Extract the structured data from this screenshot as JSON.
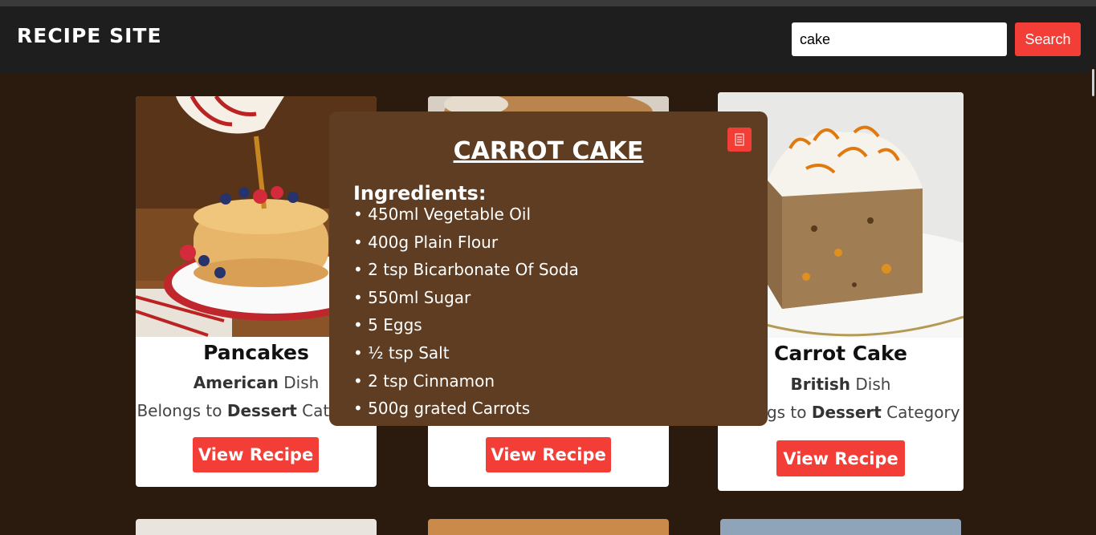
{
  "header": {
    "site_title": "RECIPE SITE",
    "search_value": "cake",
    "search_button": "Search"
  },
  "cards": [
    {
      "title": "Pancakes",
      "area": "American",
      "area_suffix": " Dish",
      "cat_prefix": "Belongs to ",
      "category": "Dessert",
      "cat_suffix": " Category",
      "button": "View Recipe"
    },
    {
      "title": "",
      "area": "",
      "area_suffix": "",
      "cat_prefix": "",
      "category": "",
      "cat_suffix": "",
      "button": "View Recipe"
    },
    {
      "title": "Carrot Cake",
      "area": "British",
      "area_suffix": " Dish",
      "cat_prefix": "Belongs to ",
      "category": "Dessert",
      "cat_suffix": " Category",
      "button": "View Recipe"
    }
  ],
  "modal": {
    "title": "CARROT CAKE",
    "ingredients_heading": "Ingredients:",
    "ingredients": [
      "450ml Vegetable Oil",
      "400g Plain Flour",
      "2 tsp Bicarbonate Of Soda",
      "550ml Sugar",
      "5 Eggs",
      "½ tsp Salt",
      "2 tsp Cinnamon",
      "500g grated Carrots"
    ]
  },
  "colors": {
    "accent": "#f23e36",
    "page_bg": "#2b1b0e",
    "header_bg": "#1e1e1e",
    "modal_bg": "#5e3d22"
  },
  "icons": {
    "close": "close-icon"
  }
}
